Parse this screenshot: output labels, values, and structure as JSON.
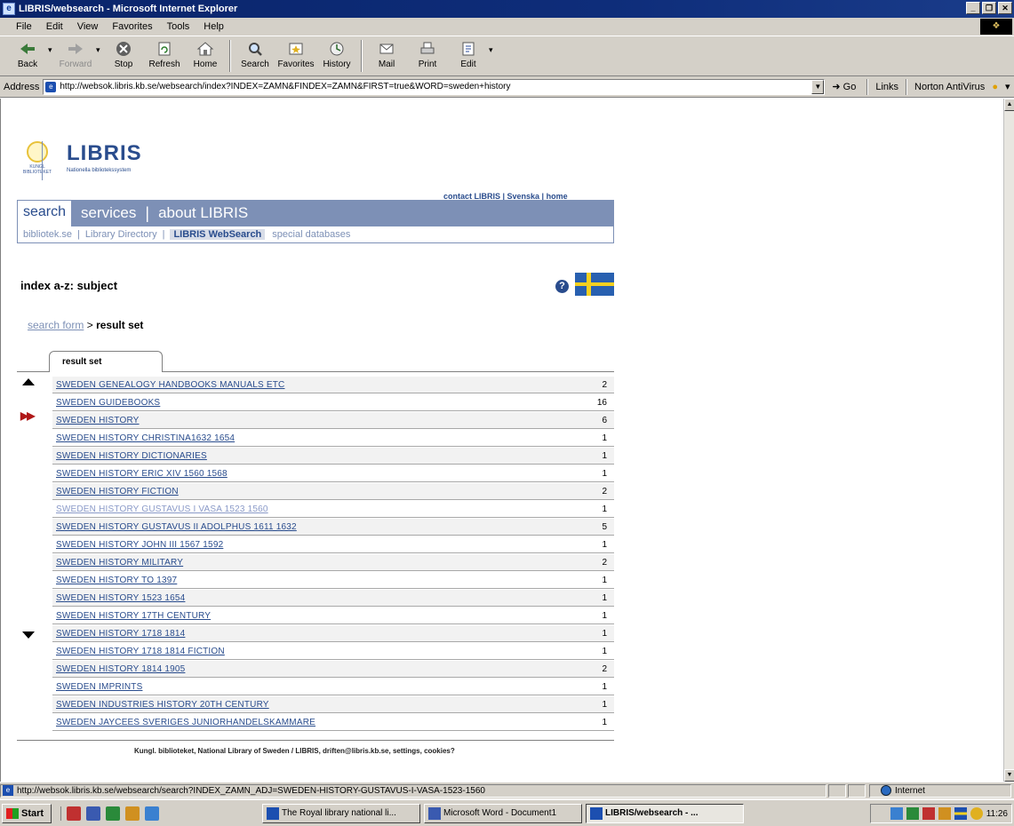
{
  "window": {
    "title": "LIBRIS/websearch - Microsoft Internet Explorer"
  },
  "menubar": {
    "items": [
      "File",
      "Edit",
      "View",
      "Favorites",
      "Tools",
      "Help"
    ]
  },
  "toolbar": {
    "back": "Back",
    "forward": "Forward",
    "stop": "Stop",
    "refresh": "Refresh",
    "home": "Home",
    "search": "Search",
    "favorites": "Favorites",
    "history": "History",
    "mail": "Mail",
    "print": "Print",
    "edit": "Edit"
  },
  "address": {
    "label": "Address",
    "url": "http://websok.libris.kb.se/websearch/index?INDEX=ZAMN&FINDEX=ZAMN&FIRST=true&WORD=sweden+history",
    "go": "Go",
    "links": "Links",
    "norton": "Norton AntiVirus"
  },
  "site": {
    "brand": "LIBRIS",
    "brand_sub": "Nationella bibliotekssystem",
    "top_links": "contact LIBRIS | Svenska | home",
    "nav": {
      "search": "search",
      "services": "services",
      "sep": "|",
      "about": "about LIBRIS"
    },
    "subnav": [
      "bibliotek.se",
      "Library Directory",
      "LIBRIS WebSearch",
      "special databases"
    ],
    "subnav_sep": "|",
    "heading": "index a-z: subject",
    "help": "?",
    "breadcrumb": {
      "link": "search form",
      "sep": ">",
      "current": "result set"
    },
    "tab": "result set"
  },
  "results": [
    {
      "term": "SWEDEN GENEALOGY HANDBOOKS MANUALS ETC",
      "count": "2"
    },
    {
      "term": "SWEDEN GUIDEBOOKS",
      "count": "16"
    },
    {
      "term": "SWEDEN HISTORY",
      "count": "6"
    },
    {
      "term": "SWEDEN HISTORY CHRISTINA1632 1654",
      "count": "1"
    },
    {
      "term": "SWEDEN HISTORY DICTIONARIES",
      "count": "1"
    },
    {
      "term": "SWEDEN HISTORY ERIC XIV 1560 1568",
      "count": "1"
    },
    {
      "term": "SWEDEN HISTORY FICTION",
      "count": "2"
    },
    {
      "term": "SWEDEN HISTORY GUSTAVUS I VASA 1523 1560",
      "count": "1"
    },
    {
      "term": "SWEDEN HISTORY GUSTAVUS II ADOLPHUS 1611 1632",
      "count": "5"
    },
    {
      "term": "SWEDEN HISTORY JOHN III 1567 1592",
      "count": "1"
    },
    {
      "term": "SWEDEN HISTORY MILITARY",
      "count": "2"
    },
    {
      "term": "SWEDEN HISTORY TO 1397",
      "count": "1"
    },
    {
      "term": "SWEDEN HISTORY 1523 1654",
      "count": "1"
    },
    {
      "term": "SWEDEN HISTORY 17TH CENTURY",
      "count": "1"
    },
    {
      "term": "SWEDEN HISTORY 1718 1814",
      "count": "1"
    },
    {
      "term": "SWEDEN HISTORY 1718 1814 FICTION",
      "count": "1"
    },
    {
      "term": "SWEDEN HISTORY 1814 1905",
      "count": "2"
    },
    {
      "term": "SWEDEN IMPRINTS",
      "count": "1"
    },
    {
      "term": "SWEDEN INDUSTRIES HISTORY 20TH CENTURY",
      "count": "1"
    },
    {
      "term": "SWEDEN JAYCEES SVERIGES JUNIORHANDELSKAMMARE",
      "count": "1"
    }
  ],
  "footer": "Kungl. biblioteket, National Library of Sweden / LIBRIS, driften@libris.kb.se, settings, cookies?",
  "statusbar": {
    "url": "http://websok.libris.kb.se/websearch/search?INDEX_ZAMN_ADJ=SWEDEN-HISTORY-GUSTAVUS-I-VASA-1523-1560",
    "zone": "Internet"
  },
  "taskbar": {
    "start": "Start",
    "tasks": [
      "The Royal library national li...",
      "Microsoft Word - Document1",
      "LIBRIS/websearch - ..."
    ],
    "clock": "11:26"
  }
}
